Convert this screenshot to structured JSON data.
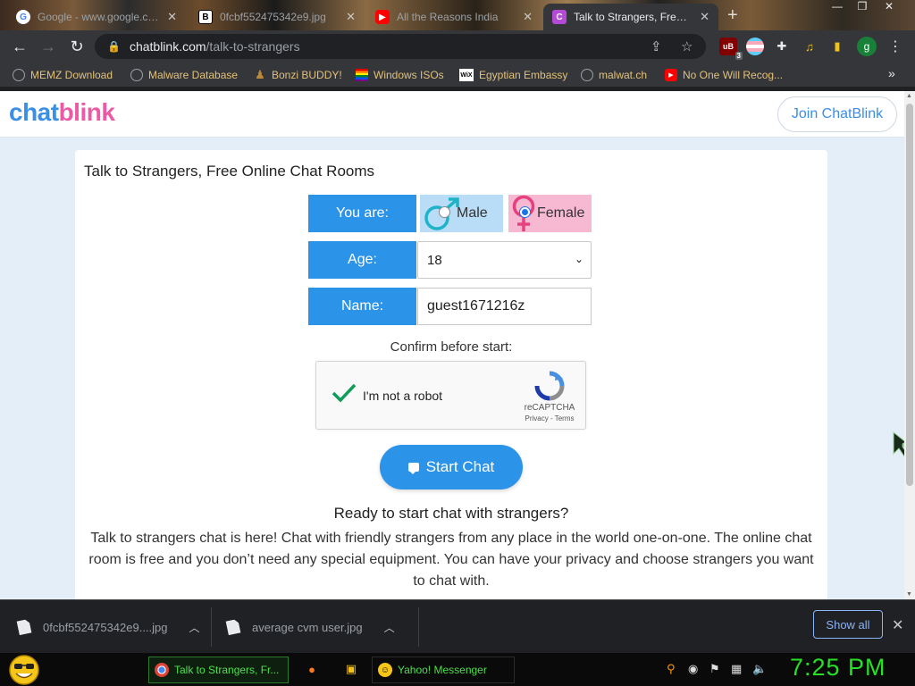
{
  "browser": {
    "tabs": [
      {
        "title": "Google - www.google.com",
        "favicon": "google-icon"
      },
      {
        "title": "0fcbf552475342e9.jpg",
        "favicon": "b-icon"
      },
      {
        "title": "All the Reasons India",
        "favicon": "youtube-icon"
      },
      {
        "title": "Talk to Strangers, Free Online Chat Rooms",
        "favicon": "chatblink-icon",
        "active": true
      }
    ],
    "address": {
      "domain": "chatblink.com",
      "path": "/talk-to-strangers"
    },
    "profile_initial": "g",
    "ublock_count": "3",
    "bookmarks": [
      {
        "label": "MEMZ Download",
        "icon": "globe-icon"
      },
      {
        "label": "Malware Database",
        "icon": "globe-icon"
      },
      {
        "label": "Bonzi BUDDY!",
        "icon": "bonzi-icon"
      },
      {
        "label": "Windows ISOs",
        "icon": "windows-icon"
      },
      {
        "label": "Egyptian Embassy",
        "icon": "wix-icon"
      },
      {
        "label": "malwat.ch",
        "icon": "globe-icon"
      },
      {
        "label": "No One Will Recog...",
        "icon": "youtube-icon"
      }
    ]
  },
  "site": {
    "logo_part1": "chat",
    "logo_part2": "blink",
    "join_label": "Join ChatBlink",
    "card_title": "Talk to Strangers, Free Online Chat Rooms",
    "form": {
      "you_are_label": "You are:",
      "male_label": "Male",
      "female_label": "Female",
      "selected_gender": "Female",
      "age_label": "Age:",
      "age_value": "18",
      "name_label": "Name:",
      "name_value": "guest1671216z"
    },
    "confirm_text": "Confirm before start:",
    "captcha": {
      "label": "I'm not a robot",
      "brand": "reCAPTCHA",
      "links": "Privacy - Terms",
      "checked": true
    },
    "start_label": "Start Chat",
    "ready_heading": "Ready to start chat with strangers?",
    "paragraph": "Talk to strangers chat is here! Chat with friendly strangers from any place in the world one-on-one. The online chat room is free and you don’t need any special equipment. You can have your privacy and choose strangers you want to chat with."
  },
  "downloads": {
    "items": [
      {
        "name": "0fcbf552475342e9....jpg"
      },
      {
        "name": "average cvm user.jpg"
      }
    ],
    "show_all_label": "Show all"
  },
  "taskbar": {
    "active_task": "Talk to Strangers, Fr...",
    "messenger_task": "Yahoo! Messenger",
    "clock": "7:25 PM"
  },
  "colors": {
    "accent_blue": "#2b93e8",
    "male_bg": "#b9ddf7",
    "female_bg": "#f7b9d2",
    "logo_blue": "#3a8ee6",
    "logo_pink": "#ec5aa6",
    "clock_green": "#28e028"
  }
}
